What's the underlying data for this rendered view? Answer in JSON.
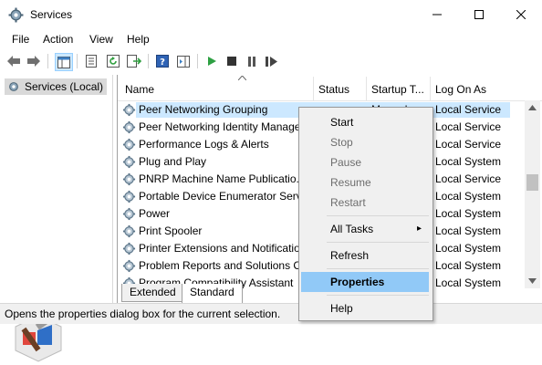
{
  "window": {
    "title": "Services",
    "icon": "gear-icon",
    "controls": [
      "minimize-icon",
      "maximize-icon",
      "close-icon"
    ]
  },
  "menu": [
    "File",
    "Action",
    "View",
    "Help"
  ],
  "toolbar_icons": [
    "back-icon",
    "forward-icon",
    "console-tree-icon",
    "properties-icon",
    "refresh-icon",
    "export-list-icon",
    "help-icon",
    "show-hide-action-pane-icon",
    "play-icon",
    "stop-icon",
    "pause-icon",
    "restart-icon"
  ],
  "tree": {
    "root_label": "Services (Local)"
  },
  "list": {
    "headers": [
      "Name",
      "Status",
      "Startup T...",
      "Log On As"
    ],
    "rows": [
      {
        "name": "Peer Networking Grouping",
        "status": "",
        "startup": "Manual",
        "logon": "Local Service"
      },
      {
        "name": "Peer Networking Identity Manage",
        "status": "",
        "startup": "",
        "logon": "Local Service"
      },
      {
        "name": "Performance Logs & Alerts",
        "status": "",
        "startup": "",
        "logon": "Local Service"
      },
      {
        "name": "Plug and Play",
        "status": "",
        "startup": "",
        "logon": "Local System"
      },
      {
        "name": "PNRP Machine Name Publicatio.",
        "status": "",
        "startup": "",
        "logon": "Local Service"
      },
      {
        "name": "Portable Device Enumerator Servi",
        "status": "",
        "startup": "",
        "logon": "Local System"
      },
      {
        "name": "Power",
        "status": "",
        "startup": "",
        "logon": "Local System"
      },
      {
        "name": "Print Spooler",
        "status": "",
        "startup": "",
        "logon": "Local System"
      },
      {
        "name": "Printer Extensions and Notificatio",
        "status": "",
        "startup": "",
        "logon": "Local System"
      },
      {
        "name": "Problem Reports and Solutions C",
        "status": "",
        "startup": "",
        "logon": "Local System"
      },
      {
        "name": "Program Compatibility Assistant",
        "status": "",
        "startup": "",
        "logon": "Local System"
      }
    ],
    "selected_index": 0
  },
  "tabs": [
    "Extended",
    "Standard"
  ],
  "active_tab": "Standard",
  "status_text": "Opens the properties dialog box for the current selection.",
  "context_menu": {
    "start": "Start",
    "stop": "Stop",
    "pause": "Pause",
    "resume": "Resume",
    "restart": "Restart",
    "all_tasks": "All Tasks",
    "refresh": "Refresh",
    "properties": "Properties",
    "help": "Help"
  },
  "colors": {
    "selection": "#cce8ff",
    "menu_highlight": "#91c9f7",
    "accent_blue": "#0078d7",
    "play_green": "#2ea043"
  }
}
